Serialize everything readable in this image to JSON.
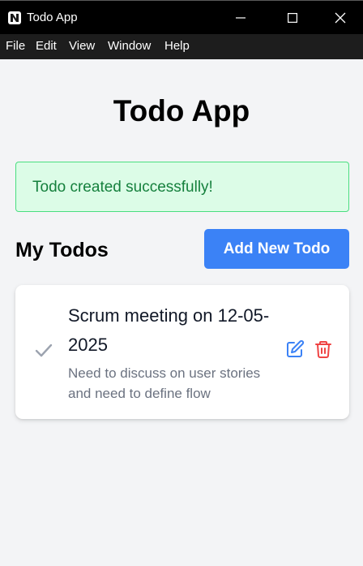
{
  "window": {
    "title": "Todo App",
    "controls": {
      "minimize": "minimize-icon",
      "maximize": "maximize-icon",
      "close": "close-icon"
    }
  },
  "menu": {
    "items": [
      "File",
      "Edit",
      "View",
      "Window",
      "Help"
    ]
  },
  "page": {
    "title": "Todo App"
  },
  "alert": {
    "message": "Todo created successfully!",
    "bg_color": "#dcfce7",
    "border_color": "#4ade80",
    "text_color": "#15803d"
  },
  "todos_section": {
    "title": "My Todos",
    "add_button_label": "Add New Todo",
    "accent_color": "#3b82f6"
  },
  "todos": [
    {
      "title": "Scrum meeting on 12-05-2025",
      "description": "Need to discuss on user stories and need to define flow",
      "completed": false,
      "icons": {
        "status": "check-icon",
        "edit": "edit-icon",
        "delete": "trash-icon"
      }
    }
  ],
  "colors": {
    "edit": "#3b82f6",
    "delete": "#ef4444",
    "check": "#9ca3af"
  }
}
